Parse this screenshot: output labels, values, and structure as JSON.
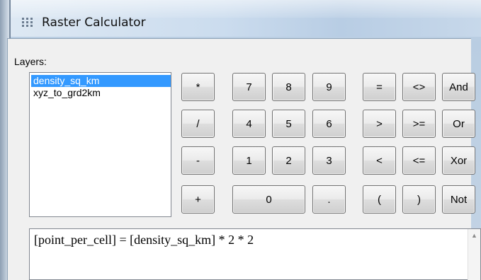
{
  "window": {
    "title": "Raster Calculator",
    "icon": "grid-dots-icon"
  },
  "layers": {
    "label": "Layers:",
    "items": [
      {
        "label": "density_sq_km",
        "selected": true
      },
      {
        "label": "xyz_to_grd2km",
        "selected": false
      }
    ]
  },
  "buttons": {
    "multiply": "*",
    "seven": "7",
    "eight": "8",
    "nine": "9",
    "equal": "=",
    "not_equal": "<>",
    "and": "And",
    "divide": "/",
    "four": "4",
    "five": "5",
    "six": "6",
    "greater": ">",
    "greater_equal": ">=",
    "or": "Or",
    "minus": "-",
    "one": "1",
    "two": "2",
    "three": "3",
    "less": "<",
    "less_equal": "<=",
    "xor": "Xor",
    "plus": "+",
    "zero": "0",
    "decimal": ".",
    "open_paren": "(",
    "close_paren": ")",
    "not": "Not"
  },
  "expression": {
    "text": "[point_per_cell] = [density_sq_km] * 2 * 2"
  },
  "colors": {
    "selection": "#3399ff",
    "title_bar": "#c7d8ea",
    "dialog_bg": "#f0f0f0"
  }
}
